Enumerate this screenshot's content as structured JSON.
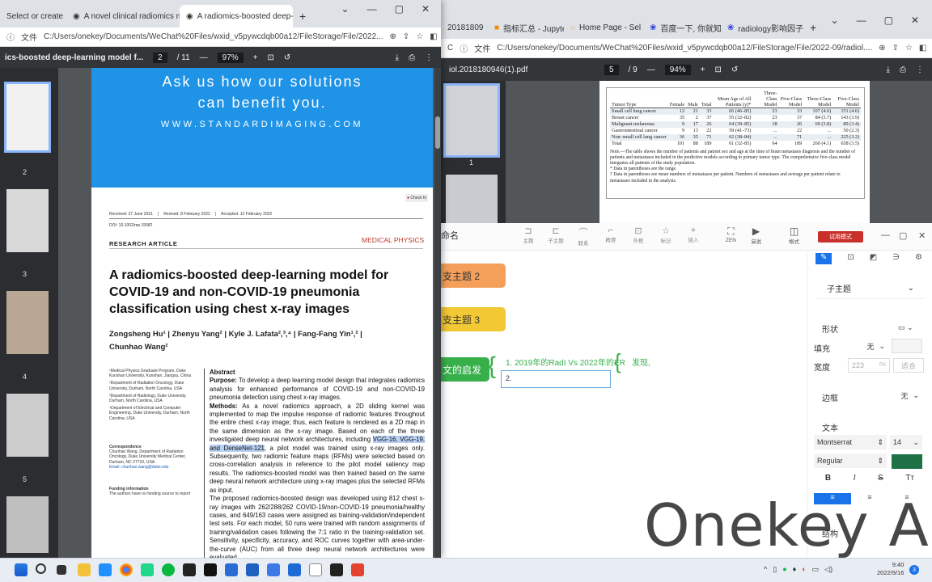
{
  "left_browser": {
    "tabs": [
      {
        "title": "Select or create"
      },
      {
        "title": "A novel clinical radiomics nom"
      },
      {
        "title": "A radiomics-boosted deep-le"
      }
    ],
    "url_prefix": "文件",
    "url": "C:/Users/onekey/Documents/WeChat%20Files/wxid_v5pywcdqb00a12/FileStorage/File/2022...",
    "pdf": {
      "filename": "ics-boosted deep-learning model f...",
      "page_current": "2",
      "page_total": "/ 11",
      "zoom": "97%",
      "thumb_numbers": [
        "2",
        "3",
        "4",
        "5"
      ]
    },
    "paper": {
      "banner_line1": "Ask us how our solutions",
      "banner_line2": "can benefit you.",
      "banner_url": "WWW.STANDARDIMAGING.COM",
      "check_label": "Check fo",
      "received": "Received: 27 June 2021",
      "revised": "Revised: 8 February 2022",
      "accepted": "Accepted: 12 February 2022",
      "doi": "DOI: 10.1002/mp.15582",
      "article_type": "RESEARCH ARTICLE",
      "journal": "MEDICAL PHYSICS",
      "title": "A radiomics-boosted deep-learning model for COVID-19 and non-COVID-19 pneumonia classification using chest x-ray images",
      "authors_line1": "Zongsheng Hu¹ | Zhenyu Yang² | Kyle J. Lafata²,³,⁴ | Fang-Fang Yin¹,² |",
      "authors_line2": "Chunhao Wang²",
      "affiliations": [
        "¹Medical Physics Graduate Program, Duke Kunshan University, Kunshan, Jiangsu, China",
        "²Department of Radiation Oncology, Duke University, Durham, North Carolina, USA",
        "³Department of Radiology, Duke University, Durham, North Carolina, USA",
        "⁴Department of Electrical and Computer Engineering, Duke University, Durham, North Carolina, USA"
      ],
      "correspondence_heading": "Correspondence",
      "correspondence_text": "Chunhao Wang, Department of Radiation Oncology, Duke University Medical Center, Durham, NC 27710, USA.",
      "correspondence_email": "Email: chunhao.wang@duke.edu",
      "funding_heading": "Funding information",
      "funding_text": "The authors have no funding source to report",
      "abstract_heading": "Abstract",
      "purpose_label": "Purpose:",
      "purpose_text": "To develop a deep learning model design that integrates radiomics analysis for enhanced performance of COVID-19 and non-COVID-19 pneumonia detection using chest x-ray images.",
      "methods_label": "Methods:",
      "methods_text_a": "As a novel radiomics approach, a 2D sliding kernel was implemented to map the impulse response of radiomic features throughout the entire chest x-ray image; thus, each feature is rendered as a 2D map in the same dimension as the x-ray image. Based on each of the three investigated deep neural network architectures, including",
      "methods_highlight": "VGG-16, VGG-19, and DenseNet-121",
      "methods_text_b": ", a pilot model was trained using x-ray images only. Subsequently, two radiomic feature maps (RFMs) were selected based on cross-correlation analysis in reference to the pilot model saliency map results. The radiomics-boosted model was then trained based on the same deep neural network architecture using x-ray images plus the selected RFMs as input.",
      "para2_text": "The proposed radiomics-boosted design was developed using 812 chest x-ray images with 262/288/262 COVID-19/non-COVID-19 pneumonia/healthy cases, and 649/163 cases were assigned as training-validation/independent test sets. For each model, 50 runs were trained with random assignments of training/validation cases following the 7:1 ratio in the training-validation set. Sensitivity, specificity, accuracy, and ROC curves together with area-under-the-curve (AUC) from all three deep neural network architectures were evaluated."
    }
  },
  "right_browser": {
    "tabs": [
      {
        "title": "20181809"
      },
      {
        "title": "指标汇总 - Jupyte"
      },
      {
        "title": "Home Page - Sel"
      },
      {
        "title": "百度一下, 你就知"
      },
      {
        "title": "radiology影响因子"
      }
    ],
    "url_prefix": "文件",
    "url": "C:/Users/onekey/Documents/WeChat%20Files/wxid_v5pywcdqb00a12/FileStorage/File/2022-09/radiol....",
    "pdf": {
      "filename": "iol.2018180946(1).pdf",
      "page_current": "5",
      "page_total": "/ 9",
      "zoom": "94%",
      "thumb_number": "1"
    },
    "table": {
      "headers": [
        "Tumor Type",
        "Female",
        "Male",
        "Total",
        "Mean Age of All Patients (y)*",
        "Three-Class Model",
        "Five-Class Model",
        "Three-Class Model",
        "Five-Class Model"
      ],
      "rows": [
        [
          "Small cell lung cancer",
          "12",
          "21",
          "33",
          "66 (46–85)",
          "23",
          "33",
          "107 (4.6)",
          "151 (4.6)"
        ],
        [
          "Breast cancer",
          "35",
          "2",
          "37",
          "55 (32–82)",
          "23",
          "37",
          "84 (3.7)",
          "143 (3.9)"
        ],
        [
          "Malignant melanoma",
          "9",
          "17",
          "26",
          "64 (39–85)",
          "18",
          "26",
          "69 (3.8)",
          "89 (3.4)"
        ],
        [
          "Gastrointestinal cancer",
          "9",
          "13",
          "22",
          "59 (41–73)",
          "...",
          "22",
          "...",
          "50 (2.3)"
        ],
        [
          "Non–small cell lung cancer",
          "36",
          "35",
          "71",
          "62 (38–84)",
          "...",
          "71",
          "...",
          "225 (3.2)"
        ],
        [
          "Total",
          "101",
          "88",
          "189",
          "61 (32–85)",
          "64",
          "189",
          "260 (4.1)",
          "658 (3.5)"
        ]
      ],
      "note": "Note.—The table shows the number of patients and patient sex and age at the time of brain metastasis diagnosis and the number of patients and metastases included in the predictive models according to primary tumor type. The comprehensive five-class model integrates all patients of the study population.",
      "footnote1": "* Data in parentheses are the range.",
      "footnote2": "† Data in parentheses are mean numbers of metastases per patient. Numbers of metastases and average per patient relate to metastases included in the analysis."
    }
  },
  "mindmap_app": {
    "title_fragment": "命名",
    "toolbar": [
      "主题",
      "子主题",
      "联系",
      "概要",
      "外框",
      "标记",
      "插入"
    ],
    "toolbar_right": [
      "ZEN",
      "演说",
      "格式"
    ],
    "trial_button": "试用模式",
    "nodes": {
      "branch2": "支主题 2",
      "branch3": "支主题 3",
      "branch4": "文的启发",
      "sub1": "1. 2019年的RadI Vs 2022年的ER",
      "sub1_child": "发现,",
      "editing_value": "2."
    },
    "panel": {
      "style_select": "子主题",
      "section_shape": "形状",
      "fill_label": "填充",
      "fill_value": "无",
      "width_label": "宽度",
      "width_value": "223",
      "width_unit": "PX",
      "width_auto": "适合",
      "section_border": "边框",
      "border_value": "无",
      "section_text": "文本",
      "font_name": "Montserrat",
      "font_size": "14",
      "font_weight": "Regular",
      "text_color": "#1e7145",
      "section_structure": "结构"
    }
  },
  "watermark": "Onekey AI",
  "taskbar": {
    "time": "9:40",
    "date": "2022/9/16",
    "notif_count": "3"
  }
}
